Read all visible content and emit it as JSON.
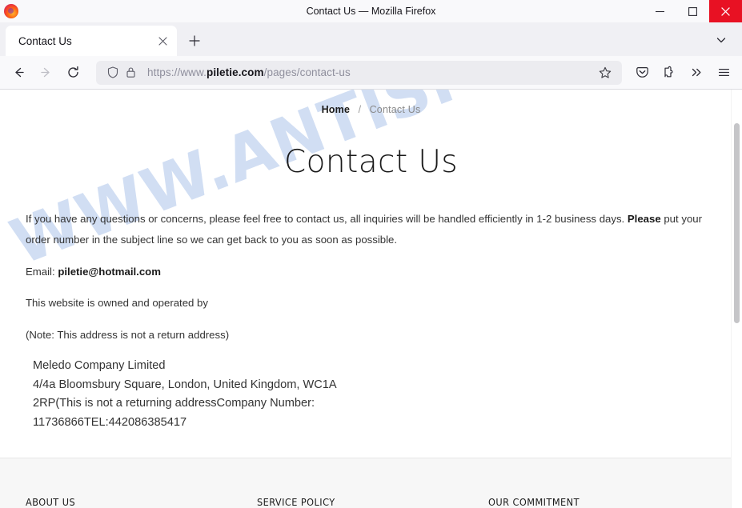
{
  "window": {
    "title": "Contact Us — Mozilla Firefox",
    "minimize_label": "Minimize",
    "maximize_label": "Maximize",
    "close_label": "Close"
  },
  "tabs": {
    "items": [
      {
        "label": "Contact Us",
        "close_label": "Close tab"
      }
    ],
    "new_tab_label": "New tab",
    "list_all_label": "List all tabs"
  },
  "toolbar": {
    "back_label": "Back",
    "forward_label": "Forward",
    "reload_label": "Reload",
    "shield_label": "Tracking protection",
    "lock_label": "Connection secure",
    "bookmark_label": "Bookmark this page",
    "pocket_label": "Save to Pocket",
    "extensions_label": "Extensions",
    "overflow_label": "More tools",
    "menu_label": "Open application menu"
  },
  "url": {
    "scheme_prefix": "https://www.",
    "host": "piletie.com",
    "path": "/pages/contact-us",
    "full": "https://www.piletie.com/pages/contact-us"
  },
  "page": {
    "breadcrumb": {
      "home": "Home",
      "separator": "/",
      "current": "Contact Us"
    },
    "title": "Contact Us",
    "paragraph_1_a": "If you have any questions or concerns, please feel free to contact us, all inquiries will be handled efficiently in 1-2 business days. ",
    "paragraph_1_b": "Please",
    "paragraph_1_c": " put your order number in the subject line so we can get back to you as soon as possible.",
    "email_label": "Email: ",
    "email_value": "piletie@hotmail.com",
    "owned_text": "This website is owned and operated by",
    "note_text": "(Note: This address is not a return address)",
    "address": "Meledo Company Limited\n4/4a Bloomsbury Square, London, United Kingdom, WC1A\n2RP(This is not a returning addressCompany Number:\n11736866TEL:442086385417",
    "watermark": "WWW.ANTISPYWARE.COM"
  },
  "footer": {
    "columns": [
      {
        "heading": "ABOUT US"
      },
      {
        "heading": "SERVICE POLICY"
      },
      {
        "heading": "OUR COMMITMENT"
      }
    ]
  },
  "colors": {
    "close_button": "#e81123",
    "watermark": "#cfddf3",
    "chrome_bg": "#f0f0f4",
    "urlbar_bg": "#ececf0"
  }
}
